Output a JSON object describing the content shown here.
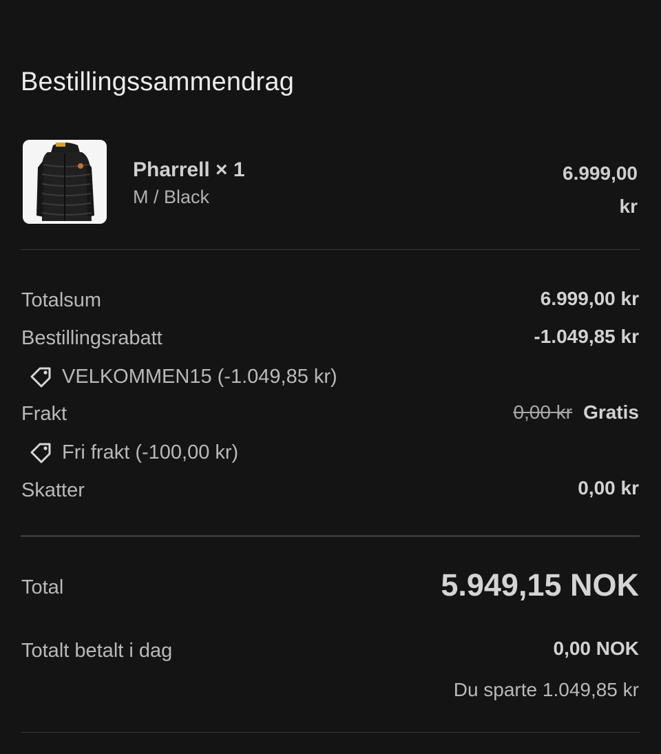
{
  "summary": {
    "heading": "Bestillingssammendrag"
  },
  "product": {
    "image_icon": "puffer-jacket-thumbnail",
    "name": "Pharrell × 1",
    "variant": "M / Black",
    "price_amount": "6.999,00",
    "price_currency": "kr"
  },
  "lines": {
    "subtotal_label": "Totalsum",
    "subtotal_value": "6.999,00 kr",
    "order_discount_label": "Bestillingsrabatt",
    "order_discount_value": "-1.049,85 kr",
    "discount_code": "VELKOMMEN15 (-1.049,85 kr)",
    "shipping_label": "Frakt",
    "shipping_original": "0,00 kr",
    "shipping_value": "Gratis",
    "shipping_discount": "Fri frakt (-100,00 kr)",
    "tax_label": "Skatter",
    "tax_value": "0,00 kr"
  },
  "totals": {
    "total_label": "Total",
    "total_value": "5.949,15 NOK",
    "paid_today_label": "Totalt betalt i dag",
    "paid_today_value": "0,00 NOK",
    "saved_text": "Du sparte 1.049,85 kr"
  },
  "colors": {
    "background": "#141414",
    "text_primary": "#d2d2d2",
    "text_secondary": "#b9b9b9",
    "divider": "#3a3a3a"
  }
}
